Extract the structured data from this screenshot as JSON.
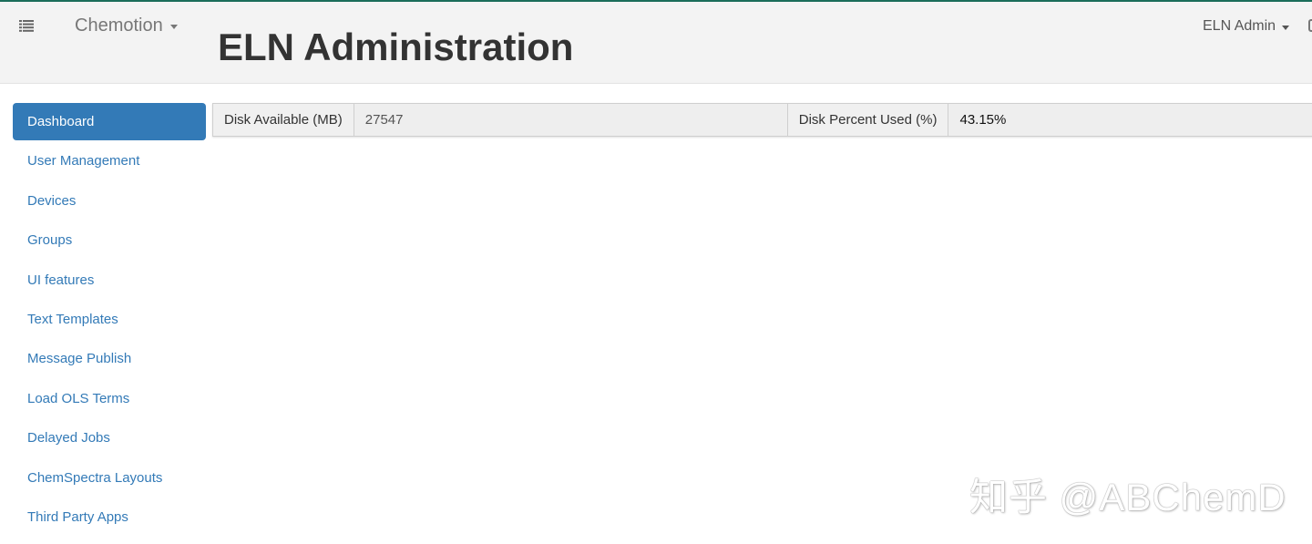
{
  "colors": {
    "accent": "#337ab7",
    "topline": "#1b6d5a",
    "navbar_bg": "#f3f3f3"
  },
  "navbar": {
    "menu_icon": "list-icon",
    "brand": "Chemotion",
    "title": "ELN Administration",
    "user": "ELN Admin"
  },
  "sidebar": {
    "items": [
      {
        "label": "Dashboard",
        "active": true
      },
      {
        "label": "User Management"
      },
      {
        "label": "Devices"
      },
      {
        "label": "Groups"
      },
      {
        "label": "UI features"
      },
      {
        "label": "Text Templates"
      },
      {
        "label": "Message Publish"
      },
      {
        "label": "Load OLS Terms"
      },
      {
        "label": "Delayed Jobs"
      },
      {
        "label": "ChemSpectra Layouts"
      },
      {
        "label": "Third Party Apps"
      }
    ]
  },
  "dashboard": {
    "disk_available_label": "Disk Available (MB)",
    "disk_available_value": "27547",
    "disk_percent_label": "Disk Percent Used (%)",
    "disk_percent_value": "43.15%"
  },
  "watermark": "知乎 @ABChemD"
}
